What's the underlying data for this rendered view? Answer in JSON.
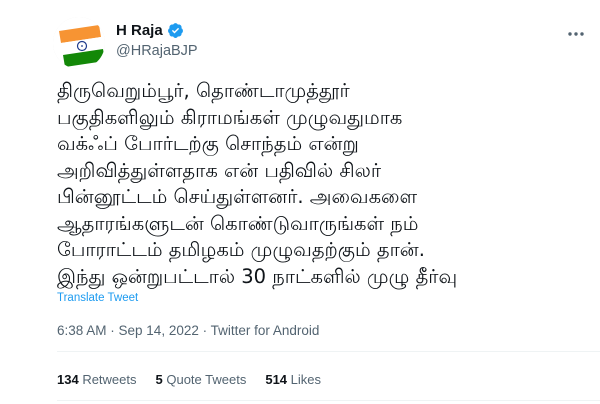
{
  "author": {
    "name": "H Raja",
    "handle": "@HRajaBJP",
    "verified": true,
    "avatar_icon": "indian-flag-avatar",
    "verified_color": "#1d9bf0"
  },
  "tweet": {
    "lines": [
      "திருவெறும்பூர், தொண்டாமுத்தூர்",
      "பகுதிகளிலும் கிராமங்கள் முழுவதுமாக",
      "வக்ஃப் போர்டற்கு சொந்தம் என்று",
      "அறிவித்துள்ளதாக என் பதிவில் சிலர்",
      "பின்னூட்டம் செய்துள்ளனர். அவைகளை",
      "ஆதாரங்களுடன் கொண்டுவாருங்கள் நம்",
      "போராட்டம் தமிழகம் முழுவதற்கும் தான்.",
      "இந்து  ஒன்றுபட்டால் 30 நாட்களில் முழு தீர்வு"
    ],
    "translate_label": "Translate Tweet"
  },
  "meta": {
    "time": "6:38 AM",
    "separator": " · ",
    "date": "Sep 14, 2022",
    "source": "Twitter for Android"
  },
  "stats": {
    "retweets_count": "134",
    "retweets_label": " Retweets",
    "quotes_count": "5",
    "quotes_label": " Quote Tweets",
    "likes_count": "514",
    "likes_label": " Likes"
  },
  "icons": {
    "more": "more-options-icon",
    "verified": "verified-badge-icon"
  },
  "colors": {
    "link": "#1d9bf0",
    "secondary_text": "#536471",
    "primary_text": "#0f1419",
    "flag_saffron": "#f79433",
    "flag_green": "#138808",
    "flag_chakra": "#1f3b8c"
  }
}
